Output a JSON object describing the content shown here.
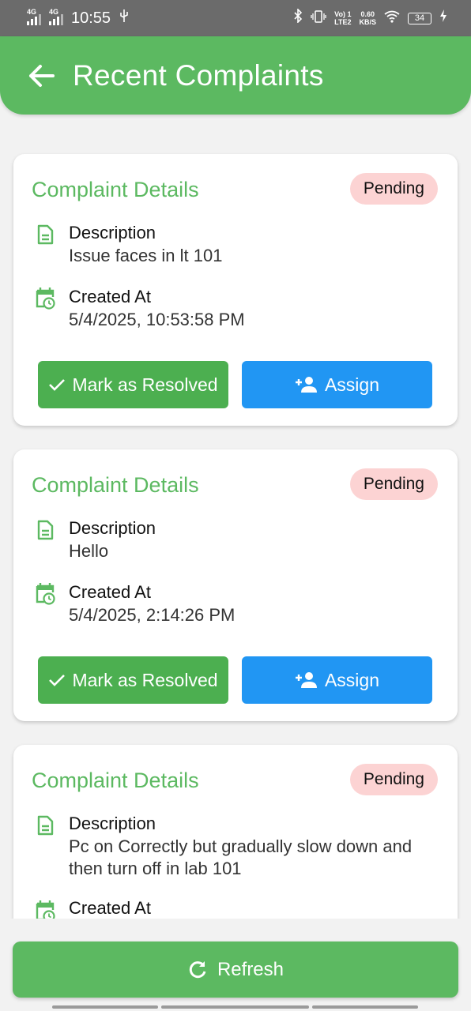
{
  "status_bar": {
    "time": "10:55",
    "network1": "4G",
    "network2": "4G",
    "volte": "Vo) 1",
    "lte": "LTE2",
    "speed_value": "0.60",
    "speed_unit": "KB/S",
    "battery": "34"
  },
  "header": {
    "title": "Recent Complaints"
  },
  "complaints": [
    {
      "title": "Complaint Details",
      "status": "Pending",
      "description_label": "Description",
      "description": "Issue faces in lt 101",
      "created_label": "Created At",
      "created_at": "5/4/2025, 10:53:58 PM",
      "resolve_label": "Mark as Resolved",
      "assign_label": "Assign"
    },
    {
      "title": "Complaint Details",
      "status": "Pending",
      "description_label": "Description",
      "description": "Hello",
      "created_label": "Created At",
      "created_at": "5/4/2025, 2:14:26 PM",
      "resolve_label": "Mark as Resolved",
      "assign_label": "Assign"
    },
    {
      "title": "Complaint Details",
      "status": "Pending",
      "description_label": "Description",
      "description": "Pc on Correctly but gradually slow down and then turn off in lab 101",
      "created_label": "Created At"
    }
  ],
  "footer": {
    "refresh_label": "Refresh"
  },
  "colors": {
    "primary_green": "#5cb961",
    "resolve_green": "#4caf50",
    "assign_blue": "#2196f3",
    "pending_badge": "#fcd3d3"
  },
  "icons": [
    "back-arrow-icon",
    "document-icon",
    "calendar-clock-icon",
    "check-icon",
    "person-add-icon",
    "refresh-icon"
  ]
}
